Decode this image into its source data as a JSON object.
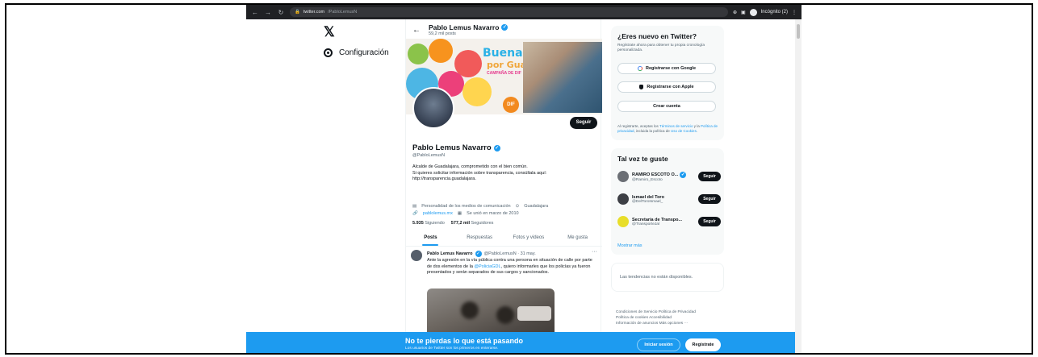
{
  "browser": {
    "url_domain": "twitter.com",
    "url_path": "/PabloLemusN",
    "profile_label": "Incógnito (2)"
  },
  "nav": {
    "config_label": "Configuración"
  },
  "profile": {
    "header_name": "Pablo Lemus Navarro",
    "header_posts": "59,2 mil posts",
    "banner_title": "Buenas acciones",
    "banner_subtitle": "por Guadalajara",
    "banner_tagline": "CAMPAÑA DE DIF",
    "banner_badge": "DIF",
    "follow_button": "Seguir",
    "name": "Pablo Lemus Navarro",
    "handle": "@PabloLemusN",
    "bio_line1": "Alcalde de Guadalajara, comprometido con el bien común.",
    "bio_line2": "Si quieres solicitar información sobre transparencia, consúltala aquí:",
    "bio_line3": "http://transparencia.guadalajara.",
    "category": "Personalidad de los medios de comunicación",
    "location": "Guadalajara",
    "website": "pablolemus.mx",
    "joined": "Se unió en marzo de 2010",
    "following_count": "5.935",
    "following_label": "Siguiendo",
    "followers_count": "577,2 mil",
    "followers_label": "Seguidores"
  },
  "tabs": [
    {
      "label": "Posts"
    },
    {
      "label": "Respuestas"
    },
    {
      "label": "Fotos y videos"
    },
    {
      "label": "Me gusta"
    }
  ],
  "post": {
    "author": "Pablo Lemus Navarro",
    "handle_time": "@PabloLemusN · 31 may.",
    "text_before": "Ante la agresión en la vía pública contra una persona en situación de calle por parte de dos elementos de la ",
    "mention": "@PoliciaGDL",
    "text_after": ", quiero informarles que los policías ya fueron presentados y serán separados de sus cargos y sancionados.",
    "more": "···"
  },
  "signup": {
    "title": "¿Eres nuevo en Twitter?",
    "text": "Regístrate ahora para obtener tu propia cronología personalizada.",
    "google": "Registrarse con Google",
    "apple": "Registrarse con Apple",
    "create": "Crear cuenta",
    "terms_before": "Al registrarte, aceptas los ",
    "terms_link1": "Términos de servicio",
    "terms_mid": " y la ",
    "terms_link2": "Política de privacidad",
    "terms_mid2": ", incluida la política de ",
    "terms_link3": "Uso de Cookies",
    "terms_end": "."
  },
  "suggestions": {
    "title": "Tal vez te guste",
    "items": [
      {
        "name": "RAMIRO ESCOTO O...",
        "handle": "@Ramiro_Escoto",
        "button": "Seguir",
        "color": "#6b6f75"
      },
      {
        "name": "Ismael del Toro",
        "handle": "@DelToroIsmael_",
        "button": "Seguir",
        "color": "#3d3f45"
      },
      {
        "name": "Secretaría de Transpo...",
        "handle": "@TransporteJal",
        "button": "Seguir",
        "color": "#e8de2a"
      }
    ],
    "show_more": "Mostrar más"
  },
  "trends": {
    "text": "Las tendencias no están disponibles."
  },
  "footer": {
    "line1": "Condiciones de Servicio   Política de Privacidad",
    "line2": "Política de cookies   Accesibilidad",
    "line3": "Información de anuncios   Más opciones ···"
  },
  "bottom_bar": {
    "title": "No te pierdas lo que está pasando",
    "subtitle": "Los usuarios de Twitter son los primeros en enterarse.",
    "login": "Iniciar sesión",
    "register": "Regístrate"
  },
  "colors": {
    "accent": "#1d9bf0",
    "chrome": "#202124",
    "dark_button": "#0f1419"
  }
}
